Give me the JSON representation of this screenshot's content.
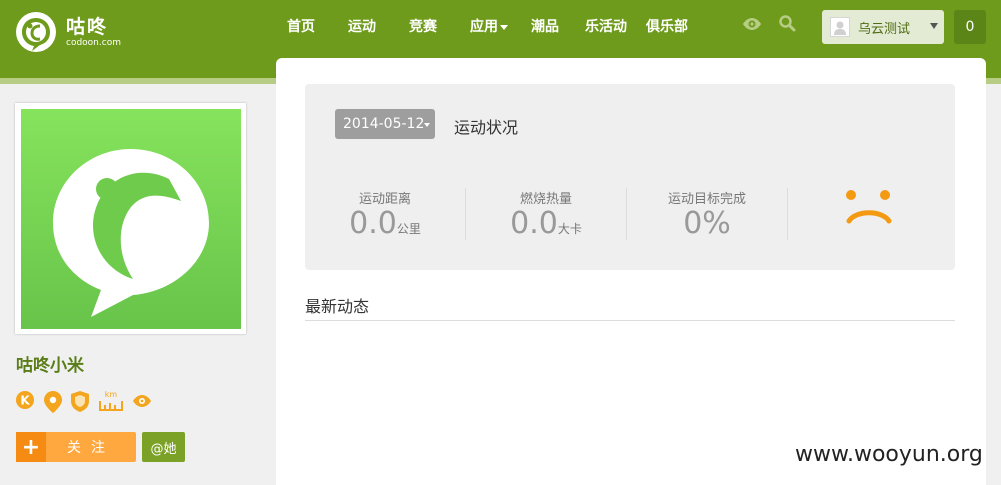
{
  "header": {
    "logo_cn": "咕咚",
    "logo_en": "codoon.com",
    "nav": [
      {
        "label": "首页"
      },
      {
        "label": "运动"
      },
      {
        "label": "竞赛"
      },
      {
        "label": "应用"
      },
      {
        "label": "潮品"
      },
      {
        "label": "乐活动"
      },
      {
        "label": "俱乐部"
      }
    ],
    "user_name": "乌云测试",
    "message_count": "0",
    "icons": [
      "eye-icon",
      "search-icon",
      "user-avatar-icon",
      "chevron-down-icon"
    ]
  },
  "status": {
    "date": "2014-05-12",
    "title": "运动状况",
    "stats": [
      {
        "label": "运动距离",
        "value": "0.0",
        "unit": "公里"
      },
      {
        "label": "燃烧热量",
        "value": "0.0",
        "unit": "大卡"
      },
      {
        "label": "运动目标完成",
        "value": "0%",
        "unit": ""
      }
    ],
    "mood_icon": "sad-face-icon"
  },
  "feed": {
    "title": "最新动态"
  },
  "profile": {
    "name": "咕咚小米",
    "badges": [
      "k-badge-icon",
      "location-pin-icon",
      "shield-icon",
      "km-ruler-icon",
      "eye-icon"
    ],
    "follow_plus": "+",
    "follow_label": "关注",
    "at_label": "@她"
  },
  "watermark": "www.wooyun.org",
  "colors": {
    "header_green": "#6f9b1c",
    "accent_orange": "#f58b13",
    "name_green": "#5a7d18"
  }
}
